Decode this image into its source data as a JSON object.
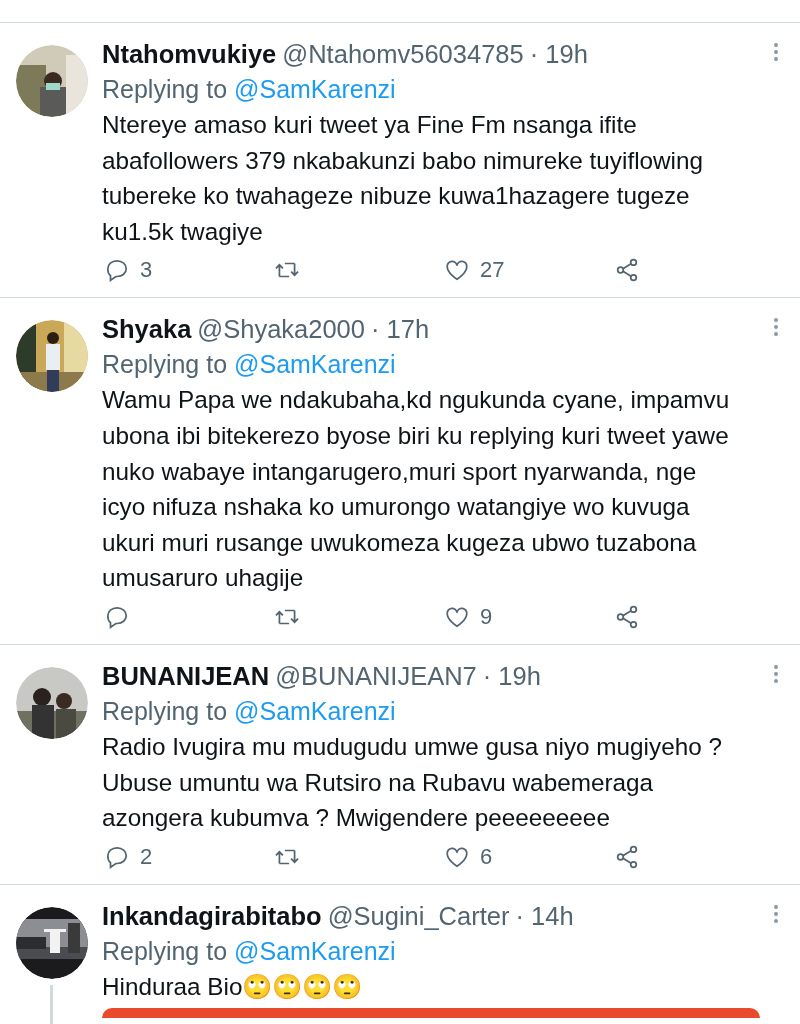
{
  "tweets": [
    {
      "name": "Ntahomvukiye",
      "handle": "@Ntahomv56034785",
      "time": "· 19h",
      "replying_label": "Replying to",
      "replying_to": "@SamKarenzi",
      "text": "Ntereye amaso kuri tweet ya Fine Fm nsanga ifite abafollowers 379 nkabakunzi babo nimureke tuyiflowing tubereke ko twahageze nibuze kuwa1hazagere tugeze ku1.5k twagiye",
      "replies": "3",
      "likes": "27"
    },
    {
      "name": "Shyaka",
      "handle": "@Shyaka2000",
      "time": "· 17h",
      "replying_label": "Replying to",
      "replying_to": "@SamKarenzi",
      "text": "Wamu Papa we ndakubaha,kd ngukunda cyane, impamvu ubona ibi bitekerezo byose biri ku replying kuri tweet yawe nuko wabaye intangarugero,muri sport nyarwanda, nge icyo nifuza nshaka ko umurongo watangiye wo kuvuga ukuri muri rusange uwukomeza kugeza ubwo tuzabona umusaruro uhagije",
      "likes": "9"
    },
    {
      "name": "BUNANIJEAN",
      "handle": "@BUNANIJEAN7",
      "time": "· 19h",
      "replying_label": "Replying to",
      "replying_to": "@SamKarenzi",
      "text": "Radio Ivugira mu mudugudu umwe gusa niyo mugiyeho ? Ubuse umuntu wa Rutsiro na Rubavu wabemeraga azongera kubumva ? Mwigendere peeeeeeeee",
      "replies": "2",
      "likes": "6"
    },
    {
      "name": "Inkandagirabitabo",
      "handle": "@Sugini_Carter",
      "time": "· 14h",
      "replying_label": "Replying to",
      "replying_to": "@SamKarenzi",
      "text": "Hinduraa Bio🙄🙄🙄🙄",
      "thread": true,
      "media": true
    }
  ]
}
